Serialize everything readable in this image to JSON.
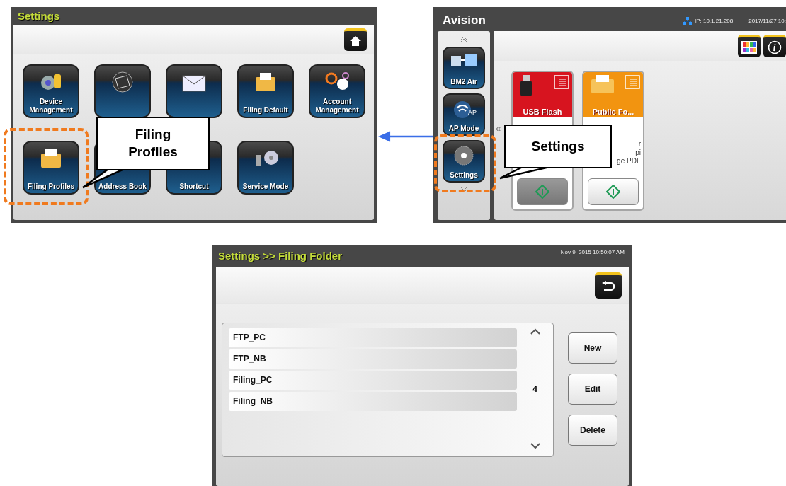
{
  "settings_screen": {
    "title": "Settings",
    "tiles": [
      {
        "label": "Device Management",
        "highlighted": false
      },
      {
        "highlighted": false
      },
      {
        "highlighted": false
      },
      {
        "label": "Filing Default",
        "highlighted": false
      },
      {
        "label": "Account Management",
        "highlighted": false
      },
      {
        "label": "Filing Profiles",
        "highlighted": true
      },
      {
        "label": "Address Book",
        "highlighted": false
      },
      {
        "label": "Shortcut",
        "highlighted": false
      },
      {
        "label": "Service Mode",
        "highlighted": false
      }
    ],
    "callout": "Filing Profiles"
  },
  "home_screen": {
    "brand": "Avision",
    "ip": "IP: 10.1.21.208",
    "datetime": "2017/11/27 10:",
    "sidebar": [
      {
        "label": "BM2 Air",
        "highlighted": false
      },
      {
        "label": "AP Mode",
        "badge": "AP",
        "highlighted": false
      },
      {
        "label": "Settings",
        "highlighted": true
      }
    ],
    "scroll_left": "«",
    "cards": [
      {
        "title": "USB Flash",
        "color": "#d7141f",
        "pressed": true
      },
      {
        "title": "Public Fo...",
        "color": "#f29410",
        "details": [
          "r",
          "pi",
          "ge PDF"
        ],
        "pressed": false
      }
    ],
    "callout": "Settings"
  },
  "filing_folder_screen": {
    "title": "Settings >> Filing Folder",
    "datetime": "Nov 9, 2015 10:50:07 AM",
    "items": [
      "FTP_PC",
      "FTP_NB",
      "Filing_PC",
      "Filing_NB"
    ],
    "count": "4",
    "buttons": [
      "New",
      "Edit",
      "Delete"
    ]
  }
}
